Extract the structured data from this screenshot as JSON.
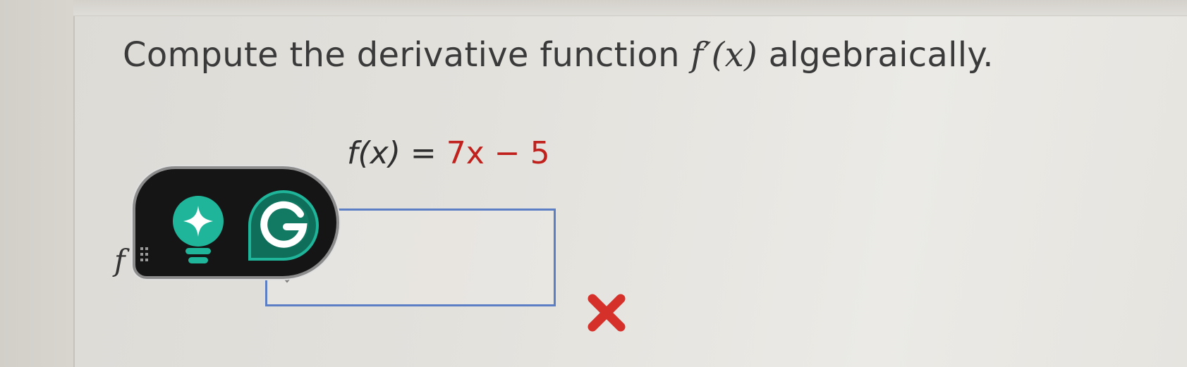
{
  "question": {
    "prefix": "Compute the derivative function ",
    "fprime": "f′(x)",
    "suffix": " algebraically."
  },
  "equation": {
    "lhs": "f(x) = ",
    "rhs": "7x − 5"
  },
  "answer": {
    "label": "f",
    "value": ""
  },
  "status": {
    "result": "incorrect",
    "color": "#d6302b"
  },
  "toolbar": {
    "hint_icon": "lightbulb-sparkle-icon",
    "grammarly_icon": "grammarly-g-icon",
    "grammarly_letter": "G",
    "accent": "#16a085",
    "dark_accent": "#0f6e5a"
  }
}
